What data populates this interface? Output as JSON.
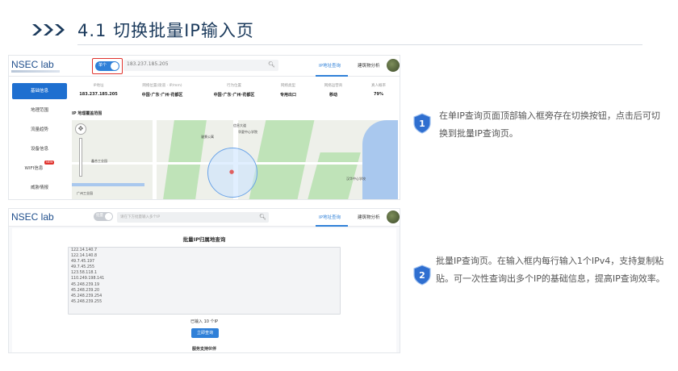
{
  "slide": {
    "title": "4.1 切换批量IP输入页"
  },
  "shot1": {
    "logo": "NSEC lab",
    "toggle_label": "单个",
    "search_value": "183.237.185.205",
    "nav": [
      "IP地址查询",
      "建筑物分析"
    ],
    "sidebar": [
      "基础信息",
      "地理范围",
      "流量趋势",
      "设备信息",
      "WIFI信息",
      "威胁情报"
    ],
    "wifi_badge": "NEW",
    "info_headers": [
      "IP地址",
      "网络位置(街道 · IP/mm)",
      "行为位置",
      "网络类型",
      "网络运营商",
      "真人概率"
    ],
    "info_values": [
      "183.237.185.205",
      "中国·广东·广州·花都区",
      "中国·广东·广州·花都区",
      "专用出口",
      "移动",
      "79%"
    ],
    "map_title": "IP 地理覆盖范围",
    "map_labels": [
      "信息大道",
      "华夏中心学院",
      "骏景公寓",
      "鑫合工业园",
      "广州工业园",
      "汉华中心学校"
    ]
  },
  "shot2": {
    "logo": "NSEC lab",
    "toggle_label": "批量",
    "search_placeholder": "请在下方批量输入多个IP",
    "nav": [
      "IP地址查询",
      "建筑物分析"
    ],
    "panel_title": "批量IP归属地查询",
    "ips": [
      "122.14.140.7",
      "122.14.140.8",
      "49.7.45.197",
      "49.7.45.255",
      "123.58.118.1",
      "110.249.198.141",
      "45.248.239.19",
      "45.248.239.20",
      "45.248.239.254",
      "45.248.239.255"
    ],
    "count_text": "已输入 10 个IP",
    "button": "立即查询",
    "footer": "服务支持伙伴"
  },
  "callouts": [
    {
      "number": "1",
      "text": "在单IP查询页面顶部输入框旁存在切换按钮，点击后可切换到批量IP查询页。"
    },
    {
      "number": "2",
      "text": "批量IP查询页。在输入框内每行输入1个IPv4，支持复制粘贴。可一次性查询出多个IP的基础信息，提高IP查询效率。"
    }
  ],
  "colors": {
    "accent": "#2f80d8",
    "title": "#1b3a5c",
    "highlight": "#e0332e",
    "chevron": "#1b3a5c"
  }
}
